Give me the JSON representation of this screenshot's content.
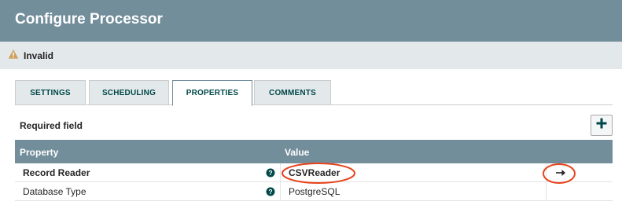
{
  "dialog": {
    "title": "Configure Processor"
  },
  "status": {
    "text": "Invalid",
    "icon": "warning-icon",
    "color": "#cf9f5d"
  },
  "tabs": [
    {
      "label": "SETTINGS",
      "active": false
    },
    {
      "label": "SCHEDULING",
      "active": false
    },
    {
      "label": "PROPERTIES",
      "active": true
    },
    {
      "label": "COMMENTS",
      "active": false
    }
  ],
  "properties_panel": {
    "required_label": "Required field",
    "add_icon": "plus-icon",
    "columns": {
      "property": "Property",
      "value": "Value"
    },
    "rows": [
      {
        "property": "Record Reader",
        "value": "CSVReader",
        "required": true,
        "has_goto": true
      },
      {
        "property": "Database Type",
        "value": "PostgreSQL",
        "required": false,
        "has_goto": false
      }
    ]
  },
  "annotation_color": "#e8431c",
  "colors": {
    "header": "#728e9b",
    "status_bg": "#e3e8eb",
    "tab_text": "#004849"
  }
}
